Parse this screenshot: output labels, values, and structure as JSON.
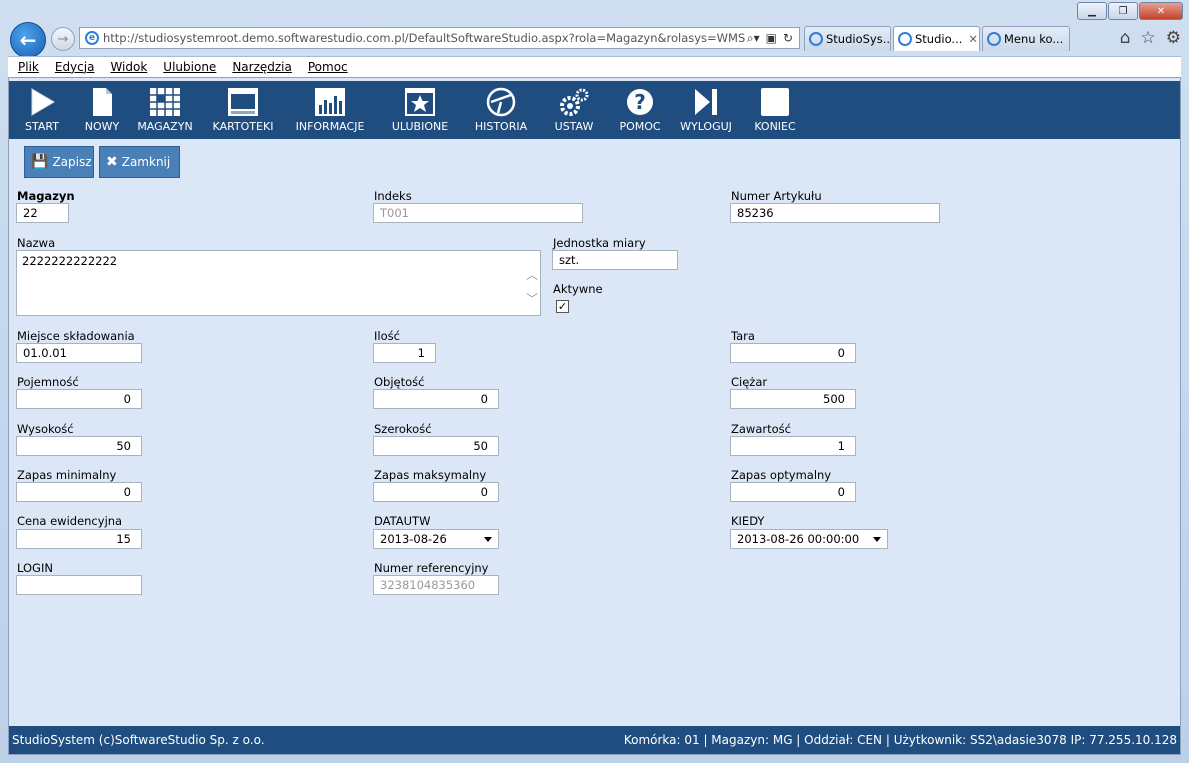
{
  "browser": {
    "url": "http://studiosystemroot.demo.softwarestudio.com.pl/DefaultSoftwareStudio.aspx?rola=Magazyn&rolasys=WMS",
    "tabs": [
      {
        "label": "StudioSys..."
      },
      {
        "label": "Studio..."
      },
      {
        "label": "Menu ko..."
      }
    ]
  },
  "menu": [
    "Plik",
    "Edycja",
    "Widok",
    "Ulubione",
    "Narzędzia",
    "Pomoc"
  ],
  "toolbar": [
    {
      "label": "START",
      "icon": "play-icon"
    },
    {
      "label": "NOWY",
      "icon": "new-document-icon"
    },
    {
      "label": "MAGAZYN",
      "icon": "grid-icon"
    },
    {
      "label": "KARTOTEKI",
      "icon": "window-icon"
    },
    {
      "label": "INFORMACJE",
      "icon": "chart-icon"
    },
    {
      "label": "ULUBIONE",
      "icon": "star-icon"
    },
    {
      "label": "HISTORIA",
      "icon": "history-icon"
    },
    {
      "label": "USTAW",
      "icon": "gears-icon"
    },
    {
      "label": "POMOC",
      "icon": "help-icon"
    },
    {
      "label": "WYLOGUJ",
      "icon": "logout-icon"
    },
    {
      "label": "KONIEC",
      "icon": "stop-icon"
    }
  ],
  "actions": {
    "save": "Zapisz",
    "close": "Zamknij"
  },
  "form": {
    "magazyn": {
      "label": "Magazyn",
      "value": "22"
    },
    "indeks": {
      "label": "Indeks",
      "value": "T001"
    },
    "numer_artykulu": {
      "label": "Numer Artykułu",
      "value": "85236"
    },
    "nazwa": {
      "label": "Nazwa",
      "value": "2222222222222"
    },
    "jednostka": {
      "label": "Jednostka miary",
      "value": "szt."
    },
    "aktywne": {
      "label": "Aktywne",
      "checked": true,
      "mark": "✓"
    },
    "miejsce": {
      "label": "Miejsce składowania",
      "value": "01.0.01"
    },
    "ilosc": {
      "label": "Ilość",
      "value": "1"
    },
    "tara": {
      "label": "Tara",
      "value": "0"
    },
    "pojemnosc": {
      "label": "Pojemność",
      "value": "0"
    },
    "objetosc": {
      "label": "Objętość",
      "value": "0"
    },
    "ciezar": {
      "label": "Ciężar",
      "value": "500"
    },
    "wysokosc": {
      "label": "Wysokość",
      "value": "50"
    },
    "szerokosc": {
      "label": "Szerokość",
      "value": "50"
    },
    "zawartosc": {
      "label": "Zawartość",
      "value": "1"
    },
    "zapas_min": {
      "label": "Zapas minimalny",
      "value": "0"
    },
    "zapas_max": {
      "label": "Zapas maksymalny",
      "value": "0"
    },
    "zapas_opt": {
      "label": "Zapas optymalny",
      "value": "0"
    },
    "cena": {
      "label": "Cena ewidencyjna",
      "value": "15"
    },
    "datautw": {
      "label": "DATAUTW",
      "value": "2013-08-26"
    },
    "kiedy": {
      "label": "KIEDY",
      "value": "2013-08-26 00:00:00"
    },
    "login": {
      "label": "LOGIN",
      "value": ""
    },
    "numer_ref": {
      "label": "Numer referencyjny",
      "value": "3238104835360"
    }
  },
  "status": {
    "left": "StudioSystem (c)SoftwareStudio Sp. z o.o.",
    "right": "Komórka: 01 | Magazyn: MG | Oddział: CEN | Użytkownik: SS2\\adasie3078 IP: 77.255.10.128"
  }
}
